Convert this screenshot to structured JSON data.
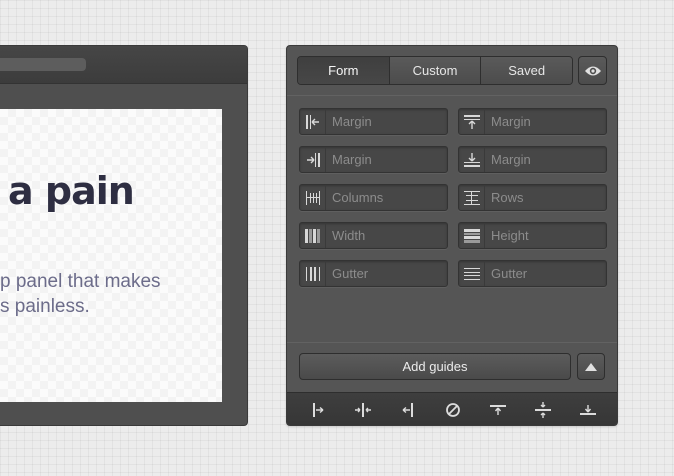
{
  "document": {
    "heading": "a pain",
    "body_line1": "p panel that makes",
    "body_line2": "s painless."
  },
  "panel": {
    "tabs": [
      {
        "label": "Form",
        "active": true
      },
      {
        "label": "Custom",
        "active": false
      },
      {
        "label": "Saved",
        "active": false
      }
    ],
    "visibility_icon": "eye-icon",
    "fields": [
      {
        "icon": "margin-left-icon",
        "placeholder": "Margin"
      },
      {
        "icon": "margin-top-icon",
        "placeholder": "Margin"
      },
      {
        "icon": "margin-right-icon",
        "placeholder": "Margin"
      },
      {
        "icon": "margin-bottom-icon",
        "placeholder": "Margin"
      },
      {
        "icon": "columns-icon",
        "placeholder": "Columns"
      },
      {
        "icon": "rows-icon",
        "placeholder": "Rows"
      },
      {
        "icon": "column-width-icon",
        "placeholder": "Width"
      },
      {
        "icon": "row-height-icon",
        "placeholder": "Height"
      },
      {
        "icon": "column-gutter-icon",
        "placeholder": "Gutter"
      },
      {
        "icon": "row-gutter-icon",
        "placeholder": "Gutter"
      }
    ],
    "add_guides_label": "Add guides",
    "collapse_icon": "triangle-up-icon",
    "toolbar_icons": [
      "guide-left-icon",
      "guide-center-vertical-icon",
      "guide-right-icon",
      "clear-guides-icon",
      "guide-top-icon",
      "guide-center-horizontal-icon",
      "guide-bottom-icon"
    ]
  },
  "colors": {
    "panel_bg": "#555555",
    "icon": "#d8d8d8",
    "heading_text": "#2e2e42",
    "body_text": "#6c6c8a"
  }
}
